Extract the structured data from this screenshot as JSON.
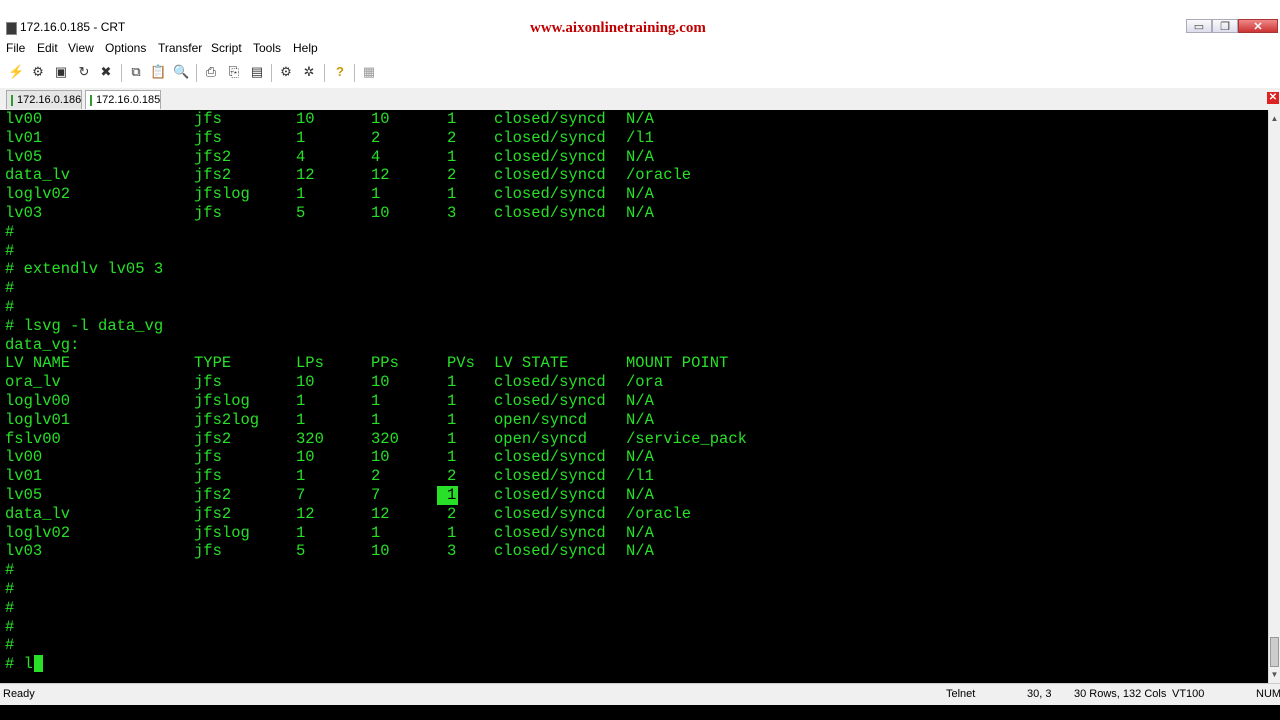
{
  "window": {
    "title": "172.16.0.185 - CRT",
    "watermark": "www.aixonlinetraining.com",
    "min_glyph": "▭",
    "max_glyph": "❐",
    "close_glyph": "✕"
  },
  "menu": [
    "File",
    "Edit",
    "View",
    "Options",
    "Transfer",
    "Script",
    "Tools",
    "Help"
  ],
  "toolbar_icons": [
    {
      "name": "connect-icon",
      "glyph": "⚡"
    },
    {
      "name": "quick-connect-icon",
      "glyph": "⚙"
    },
    {
      "name": "connect-tab-icon",
      "glyph": "▣"
    },
    {
      "name": "reconnect-icon",
      "glyph": "↻"
    },
    {
      "name": "disconnect-icon",
      "glyph": "✖"
    },
    {
      "name": "copy-icon",
      "glyph": "⧉"
    },
    {
      "name": "paste-icon",
      "glyph": "📋"
    },
    {
      "name": "find-icon",
      "glyph": "🔍"
    },
    {
      "name": "print-icon",
      "glyph": "⎙"
    },
    {
      "name": "print-setup-icon",
      "glyph": "⎘"
    },
    {
      "name": "printer-icon",
      "glyph": "▤"
    },
    {
      "name": "session-options-icon",
      "glyph": "⚙"
    },
    {
      "name": "global-options-icon",
      "glyph": "✲"
    },
    {
      "name": "help-icon",
      "glyph": "?"
    },
    {
      "name": "keymap-icon",
      "glyph": "▦"
    }
  ],
  "tabs": [
    {
      "label": "172.16.0.186",
      "active": false
    },
    {
      "label": "172.16.0.185",
      "active": true
    }
  ],
  "terminal": {
    "lines": [
      [
        "lv00",
        "jfs",
        "10",
        "10",
        "1",
        "closed/syncd",
        "N/A"
      ],
      [
        "lv01",
        "jfs",
        "1",
        "2",
        "2",
        "closed/syncd",
        "/l1"
      ],
      [
        "lv05",
        "jfs2",
        "4",
        "4",
        "1",
        "closed/syncd",
        "N/A"
      ],
      [
        "data_lv",
        "jfs2",
        "12",
        "12",
        "2",
        "closed/syncd",
        "/oracle"
      ],
      [
        "loglv02",
        "jfslog",
        "1",
        "1",
        "1",
        "closed/syncd",
        "N/A"
      ],
      [
        "lv03",
        "jfs",
        "5",
        "10",
        "3",
        "closed/syncd",
        "N/A"
      ],
      "#",
      "#",
      "# extendlv lv05 3",
      "#",
      "#",
      "# lsvg -l data_vg",
      "data_vg:",
      [
        "LV NAME",
        "TYPE",
        "LPs",
        "PPs",
        "PVs",
        "LV STATE",
        "MOUNT POINT"
      ],
      [
        "ora_lv",
        "jfs",
        "10",
        "10",
        "1",
        "closed/syncd",
        "/ora"
      ],
      [
        "loglv00",
        "jfslog",
        "1",
        "1",
        "1",
        "closed/syncd",
        "N/A"
      ],
      [
        "loglv01",
        "jfs2log",
        "1",
        "1",
        "1",
        "open/syncd",
        "N/A"
      ],
      [
        "fslv00",
        "jfs2",
        "320",
        "320",
        "1",
        "open/syncd",
        "/service_pack"
      ],
      [
        "lv00",
        "jfs",
        "10",
        "10",
        "1",
        "closed/syncd",
        "N/A"
      ],
      [
        "lv01",
        "jfs",
        "1",
        "2",
        "2",
        "closed/syncd",
        "/l1"
      ],
      [
        "lv05",
        "jfs2",
        "7",
        "7",
        "1",
        "closed/syncd",
        "N/A"
      ],
      [
        "data_lv",
        "jfs2",
        "12",
        "12",
        "2",
        "closed/syncd",
        "/oracle"
      ],
      [
        "loglv02",
        "jfslog",
        "1",
        "1",
        "1",
        "closed/syncd",
        "N/A"
      ],
      [
        "lv03",
        "jfs",
        "5",
        "10",
        "3",
        "closed/syncd",
        "N/A"
      ],
      "#",
      "#",
      "#",
      "#",
      "#",
      "# l"
    ],
    "highlight_row": 20,
    "highlight_col": 4,
    "cursor_row": 29,
    "text_color": "#27e027",
    "background": "#000000"
  },
  "status": {
    "ready": "Ready",
    "protocol": "Telnet",
    "position": "30,  3",
    "size": "30 Rows, 132 Cols",
    "emulation": "VT100",
    "num": "NUM"
  }
}
